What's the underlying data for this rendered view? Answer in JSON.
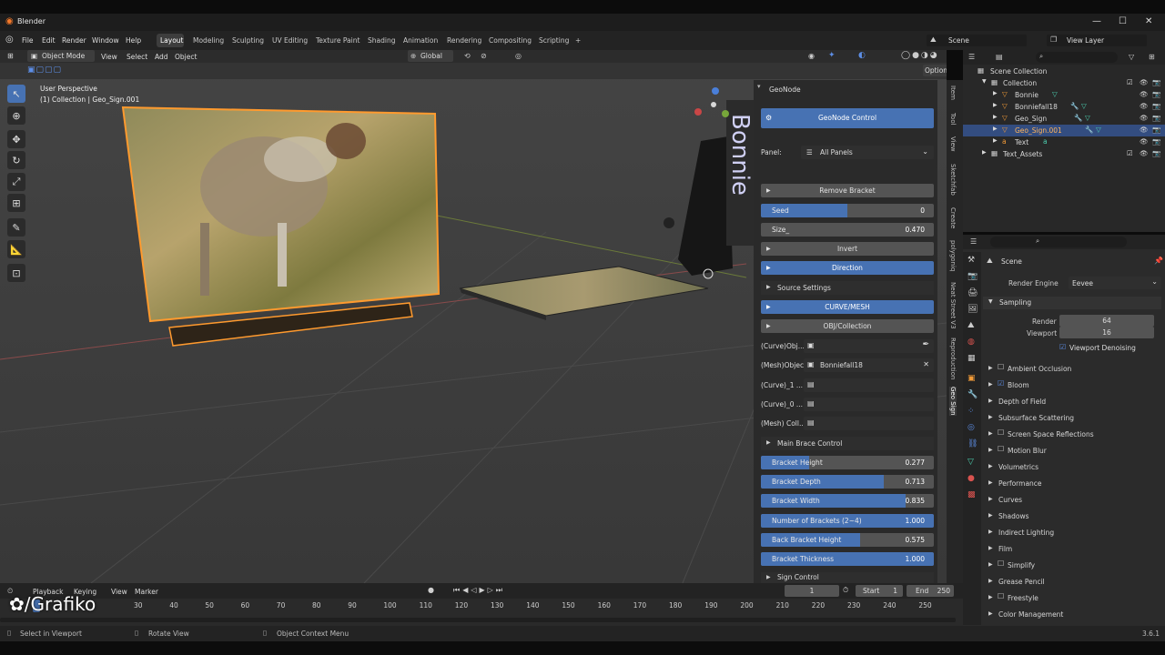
{
  "window": {
    "title": "Blender",
    "controls": [
      "—",
      "☐",
      "✕"
    ]
  },
  "menu": [
    "File",
    "Edit",
    "Render",
    "Window",
    "Help"
  ],
  "workspaces": [
    "Layout",
    "Modeling",
    "Sculpting",
    "UV Editing",
    "Texture Paint",
    "Shading",
    "Animation",
    "Rendering",
    "Compositing",
    "Scripting",
    "+"
  ],
  "scene_name": "Scene",
  "view_layer": "View Layer",
  "viewport": {
    "mode": "Object Mode",
    "menus": [
      "View",
      "Select",
      "Add",
      "Object"
    ],
    "transform": "Global",
    "options": "Options",
    "perspective": "User Perspective",
    "collection_info": "(1) Collection | Geo_Sign.001"
  },
  "npanel": {
    "header": "GeoNode",
    "main_button": "GeoNode Control",
    "panel_label": "Panel:",
    "panel_value": "All Panels",
    "remove_bracket": "Remove Bracket",
    "seed": {
      "label": "Seed",
      "value": "0",
      "fill": 0.5
    },
    "size": {
      "label": "Size_",
      "value": "0.470"
    },
    "invert": "Invert",
    "direction": "Direction",
    "source_settings": "Source Settings",
    "curve_mesh": "CURVE/MESH",
    "obj_collection": "OBJ/Collection",
    "fields": [
      {
        "label": "(Curve)Obj...",
        "value": ""
      },
      {
        "label": "(Mesh)Object:",
        "value": "Bonniefall18"
      },
      {
        "label": "(Curve)_1 ...",
        "value": ""
      },
      {
        "label": "(Curve)_0 ...",
        "value": ""
      },
      {
        "label": "(Mesh) Coll...",
        "value": ""
      }
    ],
    "main_brace": "Main Brace Control",
    "sliders": [
      {
        "label": "Bracket Height",
        "value": "0.277",
        "fill": 0.28
      },
      {
        "label": "Bracket Depth",
        "value": "0.713",
        "fill": 0.71
      },
      {
        "label": "Bracket Width",
        "value": "0.835",
        "fill": 0.835
      },
      {
        "label": "Number of Brackets (2~4)",
        "value": "1.000",
        "fill": 1.0
      },
      {
        "label": "Back Bracket Height",
        "value": "0.575",
        "fill": 0.575
      },
      {
        "label": "Bracket Thickness",
        "value": "1.000",
        "fill": 1.0
      }
    ],
    "sign_control": "Sign Control",
    "tabs": [
      "Item",
      "Tool",
      "View",
      "Sketchfab",
      "Create",
      "polygoniq",
      "Neat Street V3",
      "Reproduction",
      "Geo Sign"
    ]
  },
  "outliner": {
    "root": "Scene Collection",
    "items": [
      {
        "name": "Collection",
        "indent": 1
      },
      {
        "name": "Bonnie",
        "indent": 2
      },
      {
        "name": "Bonniefall18",
        "indent": 2
      },
      {
        "name": "Geo_Sign",
        "indent": 2
      },
      {
        "name": "Geo_Sign.001",
        "indent": 2,
        "selected": true
      },
      {
        "name": "Text",
        "indent": 2
      },
      {
        "name": "Text_Assets",
        "indent": 1
      }
    ]
  },
  "properties": {
    "context": "Scene",
    "render_engine_label": "Render Engine",
    "render_engine": "Eevee",
    "sampling": "Sampling",
    "render_label": "Render",
    "render_value": "64",
    "viewport_label": "Viewport",
    "viewport_value": "16",
    "denoise": "Viewport Denoising",
    "sections": [
      "Ambient Occlusion",
      "Bloom",
      "Depth of Field",
      "Subsurface Scattering",
      "Screen Space Reflections",
      "Motion Blur",
      "Volumetrics",
      "Performance",
      "Curves",
      "Shadows",
      "Indirect Lighting",
      "Film",
      "Simplify",
      "Grease Pencil",
      "Freestyle",
      "Color Management"
    ]
  },
  "timeline": {
    "menus": [
      "Playback",
      "Keying",
      "View",
      "Marker"
    ],
    "current_frame": "1",
    "start_label": "Start",
    "start": "1",
    "end_label": "End",
    "end": "250",
    "ticks": [
      "30",
      "40",
      "50",
      "60",
      "70",
      "80",
      "90",
      "100",
      "110",
      "120",
      "130",
      "140",
      "150",
      "160",
      "170",
      "180",
      "190",
      "200",
      "210",
      "220",
      "230",
      "240",
      "250"
    ]
  },
  "watermark": "/Grafiko",
  "status": {
    "select": "Select in Viewport",
    "rotate": "Rotate View",
    "context": "Object Context Menu",
    "version": "3.6.1"
  },
  "colors": {
    "accent": "#4772b3",
    "selection": "#ff9a2e"
  }
}
